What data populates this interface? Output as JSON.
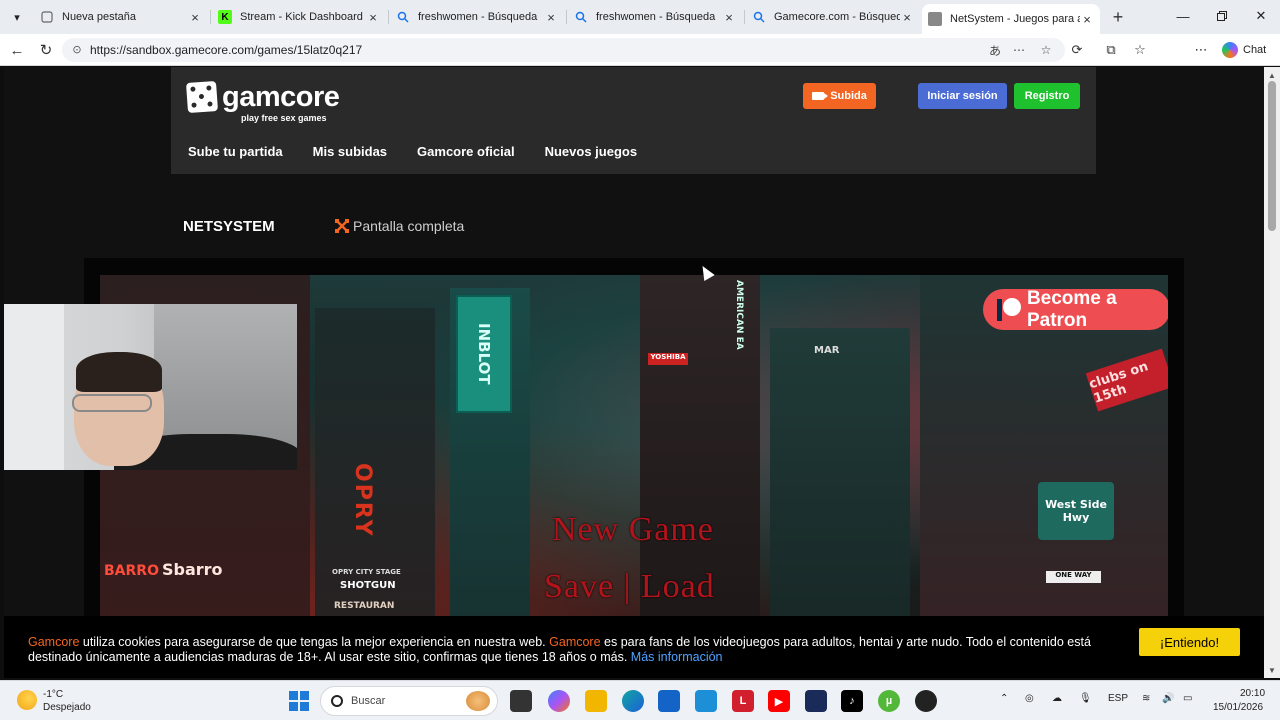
{
  "browser": {
    "tabs": [
      {
        "label": "Nueva pestaña",
        "icon": "page-icon",
        "active": false
      },
      {
        "label": "Stream - Kick Dashboard",
        "icon": "kick-icon",
        "active": false
      },
      {
        "label": "freshwomen - Búsqueda",
        "icon": "search-icon",
        "active": false
      },
      {
        "label": "freshwomen - Búsqueda",
        "icon": "search-icon",
        "active": false
      },
      {
        "label": "Gamecore.com - Búsqueda",
        "icon": "search-icon",
        "active": false
      },
      {
        "label": "NetSystem - Juegos para adu",
        "icon": "gamcore-icon",
        "active": true
      }
    ],
    "url": "https://sandbox.gamecore.com/games/15latz0q217",
    "chat_label": "Chat"
  },
  "site": {
    "logo_name": "gamcore",
    "logo_tagline": "play free sex games",
    "buttons": {
      "upload": "Subida",
      "login": "Iniciar sesión",
      "register": "Registro"
    },
    "colors": {
      "upload": "#f26522",
      "login": "#4a6cd4",
      "register": "#1fc22e",
      "cookie_accept": "#f5d10a"
    },
    "nav": [
      "Sube tu partida",
      "Mis subidas",
      "Gamcore oficial",
      "Nuevos juegos"
    ]
  },
  "game": {
    "title": "NETSYSTEM",
    "fullscreen_label": "Pantalla completa",
    "patron_label": "Become a Patron",
    "menu": {
      "new_game": "New Game",
      "save_load": "Save | Load"
    },
    "scene_signs": [
      "INBLOT",
      "YOSHIBA",
      "AMERICAN EA",
      "MAR",
      "clubs on 15th",
      "OPRY",
      "BARRO",
      "Sbarro",
      "OPRY CITY STAGE",
      "SHOTGUN",
      "RESTAURAN",
      "West Side Hwy",
      "ONE WAY"
    ]
  },
  "cookie": {
    "brand": "Gamcore",
    "text1": " utiliza cookies para asegurarse de que tengas la mejor experiencia en nuestra web. ",
    "text2": " es para fans de los videojuegos para adultos, hentai y arte nudo. Todo el contenido está destinado únicamente a audiencias maduras de 18+. Al usar este sitio, confirmas que tienes 18 años o más. ",
    "more_link": "Más información",
    "accept": "¡Entiendo!"
  },
  "taskbar": {
    "weather_temp": "-1°C",
    "weather_desc": "Despejado",
    "search_placeholder": "Buscar",
    "language": "ESP",
    "time": "20:10",
    "date": "15/01/2026"
  }
}
